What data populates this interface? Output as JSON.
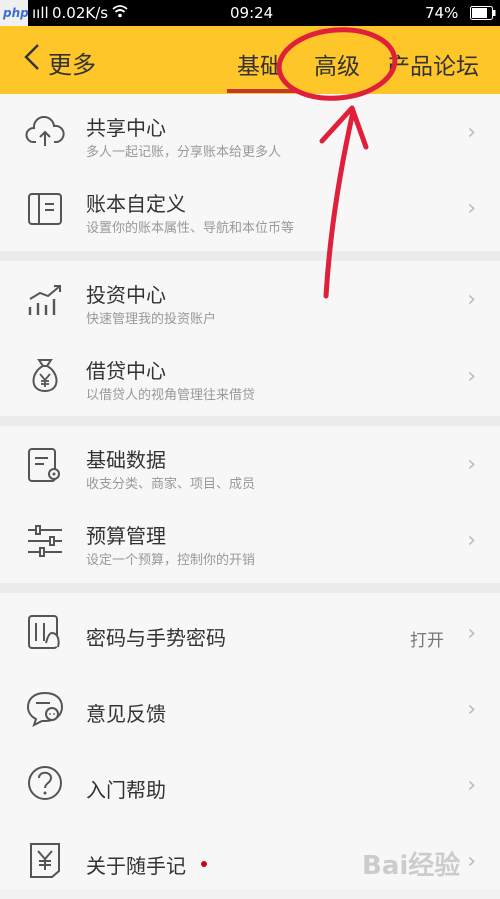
{
  "status_bar": {
    "carrier": "ııll",
    "speed": "0.02K/s",
    "time": "09:24",
    "battery": "74%"
  },
  "watermark_top": "php",
  "header": {
    "back_label": "更多",
    "tabs": [
      "基础",
      "高级",
      "产品论坛"
    ]
  },
  "sections": [
    [
      {
        "title": "共享中心",
        "sub": "多人一起记账，分享账本给更多人",
        "icon": "cloud-upload-icon"
      },
      {
        "title": "账本自定义",
        "sub": "设置你的账本属性、导航和本位币等",
        "icon": "book-icon"
      }
    ],
    [
      {
        "title": "投资中心",
        "sub": "快速管理我的投资账户",
        "icon": "chart-icon"
      },
      {
        "title": "借贷中心",
        "sub": "以借贷人的视角管理往来借贷",
        "icon": "money-bag-icon"
      }
    ],
    [
      {
        "title": "基础数据",
        "sub": "收支分类、商家、项目、成员",
        "icon": "data-settings-icon"
      },
      {
        "title": "预算管理",
        "sub": "设定一个预算，控制你的开销",
        "icon": "sliders-icon"
      }
    ]
  ],
  "settings": [
    {
      "title": "密码与手势密码",
      "value": "打开",
      "icon": "lock-gesture-icon"
    },
    {
      "title": "意见反馈",
      "icon": "chat-icon"
    },
    {
      "title": "入门帮助",
      "icon": "help-icon"
    },
    {
      "title": "关于随手记",
      "icon": "yen-icon",
      "badge": true
    }
  ],
  "watermark_bottom": "Bai经验"
}
